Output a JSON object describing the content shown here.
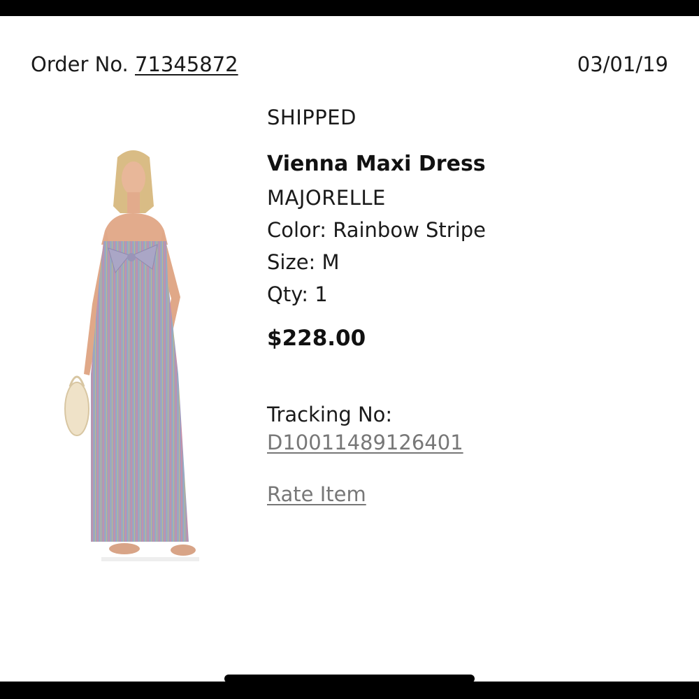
{
  "order": {
    "label": "Order No.",
    "number": "71345872",
    "date": "03/01/19"
  },
  "item": {
    "status": "SHIPPED",
    "name": "Vienna Maxi Dress",
    "brand": "MAJORELLE",
    "color": "Color: Rainbow Stripe",
    "size": "Size: M",
    "qty": "Qty: 1",
    "price": "$228.00",
    "tracking_label": "Tracking No:",
    "tracking_number": "D10011489126401",
    "rate_label": "Rate Item"
  },
  "colors": {
    "link_gray": "#777777",
    "dress_base": "#9a96b8"
  }
}
